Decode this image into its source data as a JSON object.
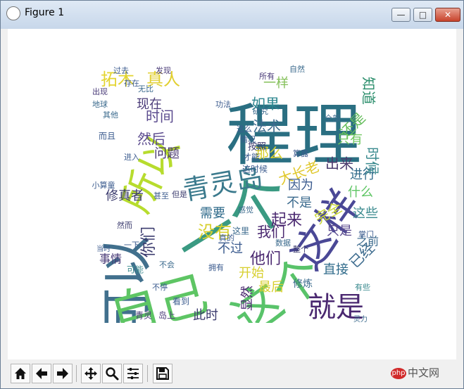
{
  "window": {
    "title": "Figure 1",
    "min_glyph": "—",
    "max_glyph": "□",
    "close_glyph": "✕"
  },
  "toolbar": {
    "items": [
      {
        "name": "home-button",
        "icon": "home-icon"
      },
      {
        "name": "back-button",
        "icon": "arrow-left-icon"
      },
      {
        "name": "forward-button",
        "icon": "arrow-right-icon"
      },
      {
        "name": "pan-button",
        "icon": "move-icon"
      },
      {
        "name": "zoom-button",
        "icon": "magnifier-icon"
      },
      {
        "name": "configure-subplots-button",
        "icon": "sliders-icon"
      },
      {
        "name": "save-button",
        "icon": "floppy-disk-icon"
      }
    ]
  },
  "watermark": {
    "logo": "php",
    "text": "中文网"
  },
  "wordcloud": {
    "words": [
      {
        "text": "程理",
        "color": "#2a6f82",
        "weight": 100
      },
      {
        "text": "一个",
        "color": "#3a9a82",
        "weight": 92
      },
      {
        "text": "可以",
        "color": "#41708d",
        "weight": 88
      },
      {
        "text": "自己",
        "color": "#5ec564",
        "weight": 80
      },
      {
        "text": "这个",
        "color": "#59c36a",
        "weight": 78
      },
      {
        "text": "这样",
        "color": "#4a4896",
        "weight": 74
      },
      {
        "text": "所以",
        "color": "#b7dc2e",
        "weight": 72
      },
      {
        "text": "青灵岛",
        "color": "#3b7a8d",
        "weight": 58
      },
      {
        "text": "就是",
        "color": "#4a2870",
        "weight": 52
      },
      {
        "text": "拓木",
        "color": "#e3d431",
        "weight": 34
      },
      {
        "text": "真人",
        "color": "#e1cf30",
        "weight": 34
      },
      {
        "text": "如果",
        "color": "#2a858e",
        "weight": 30
      },
      {
        "text": "一样",
        "color": "#85c05a",
        "weight": 28
      },
      {
        "text": "知道",
        "color": "#2d8f6d",
        "weight": 30
      },
      {
        "text": "法术",
        "color": "#3b6a8d",
        "weight": 28
      },
      {
        "text": "还是",
        "color": "#63bd5a",
        "weight": 28
      },
      {
        "text": "时间",
        "color": "#5b4b8e",
        "weight": 26
      },
      {
        "text": "现在",
        "color": "#4a3b78",
        "weight": 26
      },
      {
        "text": "然后",
        "color": "#5b4b8e",
        "weight": 26
      },
      {
        "text": "问题",
        "color": "#45336e",
        "weight": 24
      },
      {
        "text": "只有",
        "color": "#6ec65c",
        "weight": 24
      },
      {
        "text": "那么",
        "color": "#d7cf2d",
        "weight": 24
      },
      {
        "text": "大长老",
        "color": "#e0c82d",
        "weight": 24
      },
      {
        "text": "出来",
        "color": "#4a3b6e",
        "weight": 24
      },
      {
        "text": "时候",
        "color": "#3a8a8e",
        "weight": 24
      },
      {
        "text": "进行",
        "color": "#2e6a8a",
        "weight": 22
      },
      {
        "text": "修真者",
        "color": "#3b3b6e",
        "weight": 22
      },
      {
        "text": "需要",
        "color": "#2e6a8a",
        "weight": 22
      },
      {
        "text": "因为",
        "color": "#3b5b8e",
        "weight": 22
      },
      {
        "text": "没有",
        "color": "#d7cf2d",
        "weight": 24
      },
      {
        "text": "起来",
        "color": "#4a2870",
        "weight": 24
      },
      {
        "text": "完全",
        "color": "#c8d634",
        "weight": 20
      },
      {
        "text": "不是",
        "color": "#3b6a8d",
        "weight": 20
      },
      {
        "text": "什么",
        "color": "#5ec564",
        "weight": 20
      },
      {
        "text": "这些",
        "color": "#3a8a8e",
        "weight": 20
      },
      {
        "text": "我们",
        "color": "#4a2870",
        "weight": 24
      },
      {
        "text": "只是",
        "color": "#5b4b8e",
        "weight": 20
      },
      {
        "text": "你们",
        "color": "#3b3b6e",
        "weight": 24
      },
      {
        "text": "不过",
        "color": "#3b5b8e",
        "weight": 20
      },
      {
        "text": "他们",
        "color": "#4a2870",
        "weight": 24
      },
      {
        "text": "开始",
        "color": "#d7cf2d",
        "weight": 22
      },
      {
        "text": "直接",
        "color": "#2e6a8a",
        "weight": 20
      },
      {
        "text": "已经",
        "color": "#3b6a8d",
        "weight": 24
      },
      {
        "text": "事情",
        "color": "#4a3b78",
        "weight": 20
      },
      {
        "text": "之前",
        "color": "#3b6a8d",
        "weight": 18
      },
      {
        "text": "最后",
        "color": "#d7cf2d",
        "weight": 20
      },
      {
        "text": "此时",
        "color": "#3b3b6e",
        "weight": 20
      },
      {
        "text": "显然",
        "color": "#4a2870",
        "weight": 20
      },
      {
        "text": "修炼",
        "color": "#3b6a8d",
        "weight": 16
      },
      {
        "text": "青灵",
        "color": "#4a3b78",
        "weight": 14
      },
      {
        "text": "岛上",
        "color": "#4a3b78",
        "weight": 14
      },
      {
        "text": "看到",
        "color": "#3b5b8e",
        "weight": 14
      },
      {
        "text": "可能",
        "color": "#3a8a8e",
        "weight": 13
      },
      {
        "text": "而且",
        "color": "#3b5b8e",
        "weight": 13
      },
      {
        "text": "这里",
        "color": "#3b6a8d",
        "weight": 13
      },
      {
        "text": "才能",
        "color": "#3b5b8e",
        "weight": 13
      },
      {
        "text": "这时候",
        "color": "#3b5b8e",
        "weight": 13
      },
      {
        "text": "按照",
        "color": "#3b3b6e",
        "weight": 14
      },
      {
        "text": "研究",
        "color": "#3b6a8d",
        "weight": 12
      },
      {
        "text": "所有",
        "color": "#4a3b78",
        "weight": 12
      },
      {
        "text": "发现",
        "color": "#4a3b78",
        "weight": 12
      },
      {
        "text": "自然",
        "color": "#3b6a8d",
        "weight": 12
      },
      {
        "text": "进入",
        "color": "#3b5b8e",
        "weight": 12
      },
      {
        "text": "地球",
        "color": "#3b6a8d",
        "weight": 12
      },
      {
        "text": "出现",
        "color": "#4a3b78",
        "weight": 12
      },
      {
        "text": "存在",
        "color": "#3b5b8e",
        "weight": 11
      },
      {
        "text": "过去",
        "color": "#3b5b8e",
        "weight": 11
      },
      {
        "text": "小算童",
        "color": "#3b5b8e",
        "weight": 11
      },
      {
        "text": "其他",
        "color": "#3b6a8d",
        "weight": 11
      },
      {
        "text": "甚至",
        "color": "#3b5b8e",
        "weight": 11
      },
      {
        "text": "但是",
        "color": "#3b3b6e",
        "weight": 11
      },
      {
        "text": "感觉",
        "color": "#3b6a8d",
        "weight": 11
      },
      {
        "text": "真的",
        "color": "#3b5b8e",
        "weight": 11
      },
      {
        "text": "然而",
        "color": "#3b3b6e",
        "weight": 11
      },
      {
        "text": "不停",
        "color": "#3b5b8e",
        "weight": 11
      },
      {
        "text": "不会",
        "color": "#3b6a8d",
        "weight": 11
      },
      {
        "text": "拥有",
        "color": "#3b5b8e",
        "weight": 11
      },
      {
        "text": "整个",
        "color": "#3b3b6e",
        "weight": 11
      },
      {
        "text": "有些",
        "color": "#3a8a8e",
        "weight": 11
      },
      {
        "text": "掌门",
        "color": "#3b5b8e",
        "weight": 11
      },
      {
        "text": "情况",
        "color": "#3b5b8e",
        "weight": 11
      },
      {
        "text": "全部",
        "color": "#3b6a8d",
        "weight": 11
      },
      {
        "text": "算器",
        "color": "#3b5b8e",
        "weight": 11
      },
      {
        "text": "这么",
        "color": "#3b5b8e",
        "weight": 11
      },
      {
        "text": "功法",
        "color": "#3b5b8e",
        "weight": 11
      },
      {
        "text": "无比",
        "color": "#3b6a8d",
        "weight": 11
      },
      {
        "text": "一下",
        "color": "#3b5b8e",
        "weight": 11
      },
      {
        "text": "数据",
        "color": "#3b6a8d",
        "weight": 11
      },
      {
        "text": "当时",
        "color": "#3b5b8e",
        "weight": 10
      },
      {
        "text": "灵力",
        "color": "#3b6a8d",
        "weight": 10
      }
    ]
  }
}
